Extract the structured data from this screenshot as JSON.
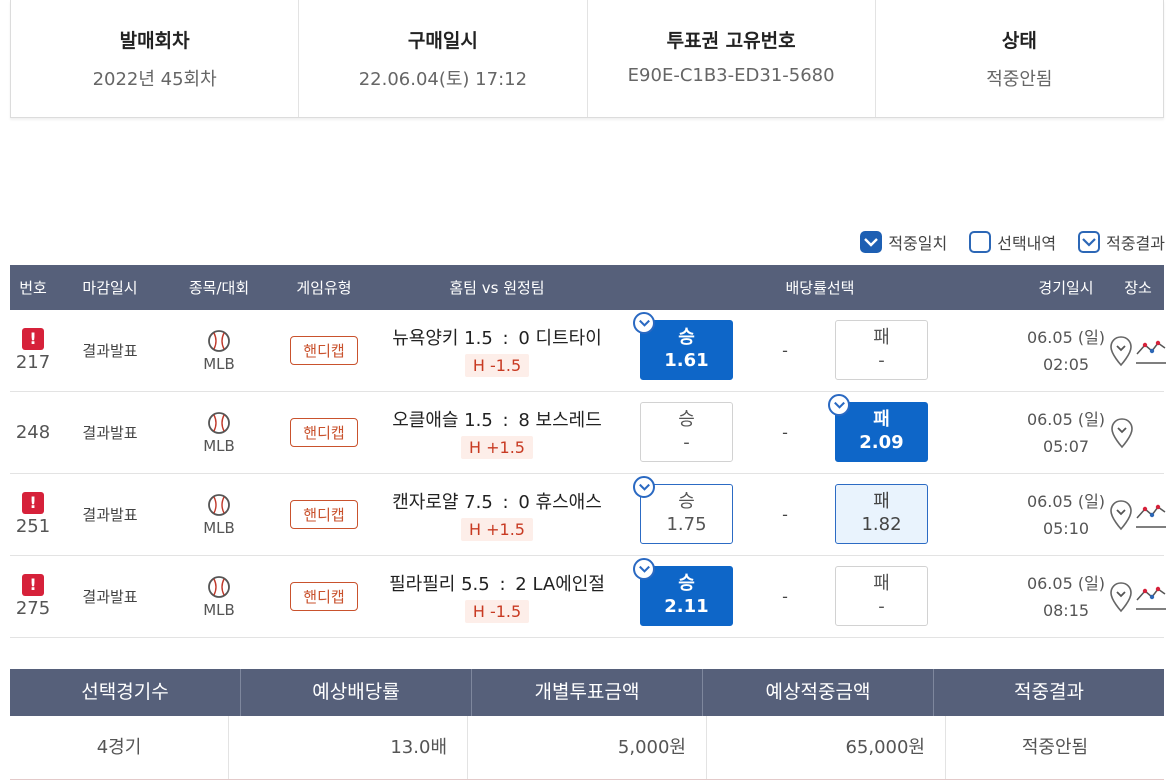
{
  "ticket_info": {
    "items": [
      {
        "label": "발매회차",
        "value": "2022년 45회차"
      },
      {
        "label": "구매일시",
        "value": "22.06.04(토) 17:12"
      },
      {
        "label": "투표권 고유번호",
        "value": "E90E-C1B3-ED31-5680"
      },
      {
        "label": "상태",
        "value": "적중안됨"
      }
    ]
  },
  "legend": {
    "match": "적중일치",
    "selection": "선택내역",
    "result": "적중결과"
  },
  "table": {
    "headers": {
      "no": "번호",
      "close": "마감일시",
      "sport": "종목/대회",
      "type": "게임유형",
      "teams": "홈팀 vs 원정팀",
      "odds": "배당률선택",
      "date": "경기일시",
      "place": "장소"
    },
    "rows": [
      {
        "no": "217",
        "alert": "!",
        "close": "결과발표",
        "sport": "MLB",
        "type": "핸디캡",
        "home": "뉴욕양키 1.5",
        "score_home": "1.5",
        "colon": ":",
        "away": "0 디트타이",
        "handicap": "H -1.5",
        "win_label": "승",
        "win_value": "1.61",
        "draw": "-",
        "lose_label": "패",
        "lose_value": "-",
        "date": "06.05 (일)",
        "time": "02:05"
      },
      {
        "no": "248",
        "alert": "",
        "close": "결과발표",
        "sport": "MLB",
        "type": "핸디캡",
        "home": "오클애슬 1.5",
        "colon": ":",
        "away": "8 보스레드",
        "handicap": "H +1.5",
        "win_label": "승",
        "win_value": "-",
        "draw": "-",
        "lose_label": "패",
        "lose_value": "2.09",
        "date": "06.05 (일)",
        "time": "05:07"
      },
      {
        "no": "251",
        "alert": "!",
        "close": "결과발표",
        "sport": "MLB",
        "type": "핸디캡",
        "home": "캔자로얄 7.5",
        "colon": ":",
        "away": "0 휴스애스",
        "handicap": "H +1.5",
        "win_label": "승",
        "win_value": "1.75",
        "draw": "-",
        "lose_label": "패",
        "lose_value": "1.82",
        "date": "06.05 (일)",
        "time": "05:10"
      },
      {
        "no": "275",
        "alert": "!",
        "close": "결과발표",
        "sport": "MLB",
        "type": "핸디캡",
        "home": "필라필리 5.5",
        "colon": ":",
        "away": "2 LA에인절",
        "handicap": "H -1.5",
        "win_label": "승",
        "win_value": "2.11",
        "draw": "-",
        "lose_label": "패",
        "lose_value": "-",
        "date": "06.05 (일)",
        "time": "08:15"
      }
    ]
  },
  "summary": {
    "headers": [
      "선택경기수",
      "예상배당률",
      "개별투표금액",
      "예상적중금액",
      "적중결과"
    ],
    "values": [
      "4경기",
      "13.0배",
      "5,000원",
      "65,000원",
      "적중안됨"
    ]
  },
  "colors": {
    "header_bg": "#56607a",
    "selected_blue": "#0e66c8",
    "alert_red": "#d6213a",
    "handicap_orange": "#c9522d"
  }
}
